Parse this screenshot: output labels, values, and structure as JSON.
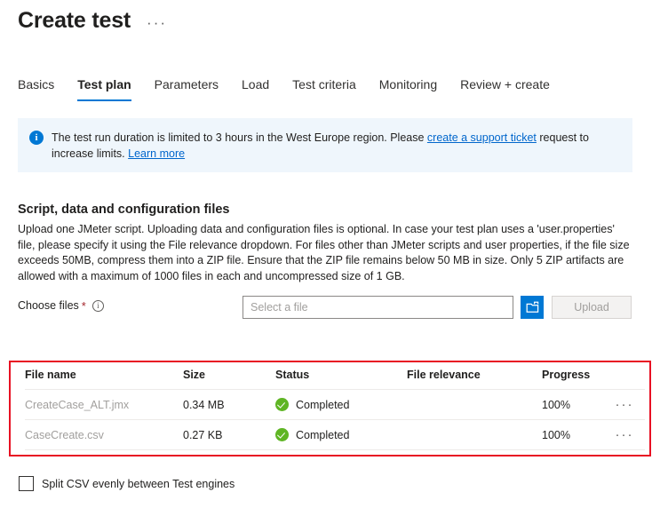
{
  "header": {
    "title": "Create test",
    "ellipsis": "···"
  },
  "tabs": [
    {
      "label": "Basics",
      "active": false
    },
    {
      "label": "Test plan",
      "active": true
    },
    {
      "label": "Parameters",
      "active": false
    },
    {
      "label": "Load",
      "active": false
    },
    {
      "label": "Test criteria",
      "active": false
    },
    {
      "label": "Monitoring",
      "active": false
    },
    {
      "label": "Review + create",
      "active": false
    }
  ],
  "banner": {
    "icon": "info-icon",
    "text_before_link": "The test run duration is limited to 3 hours in the West Europe region. Please ",
    "link1": "create a support ticket",
    "text_middle": " request to increase limits. ",
    "link2": "Learn more"
  },
  "section": {
    "heading": "Script, data and configuration files",
    "description": "Upload one JMeter script. Uploading data and configuration files is optional. In case your test plan uses a 'user.properties' file, please specify it using the File relevance dropdown. For files other than JMeter scripts and user properties, if the file size exceeds 50MB, compress them into a ZIP file. Ensure that the ZIP file remains below 50 MB in size. Only 5 ZIP artifacts are allowed with a maximum of 1000 files in each and uncompressed size of 1 GB."
  },
  "choose_files": {
    "label": "Choose files",
    "required_marker": "*",
    "info_glyph": "i",
    "input_value": "",
    "input_placeholder": "Select a file",
    "browse_icon": "folder-icon",
    "upload_label": "Upload"
  },
  "table": {
    "headers": [
      "File name",
      "Size",
      "Status",
      "File relevance",
      "Progress"
    ],
    "rows": [
      {
        "name": "CreateCase_ALT.jmx",
        "size": "0.34 MB",
        "status": "Completed",
        "status_icon": "success-check-icon",
        "relevance": "",
        "progress": "100%",
        "menu": "···"
      },
      {
        "name": "CaseCreate.csv",
        "size": "0.27 KB",
        "status": "Completed",
        "status_icon": "success-check-icon",
        "relevance": "",
        "progress": "100%",
        "menu": "···"
      }
    ]
  },
  "split_csv": {
    "label": "Split CSV evenly between Test engines",
    "checked": false
  },
  "colors": {
    "accent": "#0078d4",
    "banner_bg": "#eff6fc",
    "success": "#5fb524",
    "highlight": "#e81123",
    "required": "#a4262c"
  }
}
